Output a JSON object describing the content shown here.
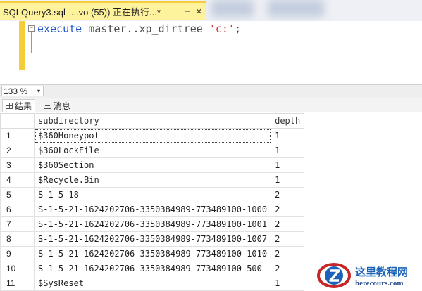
{
  "tab": {
    "title": "SQLQuery3.sql -...vo (55)) 正在执行...*",
    "pin_icon": "pin-icon",
    "close_icon": "close-icon"
  },
  "editor": {
    "fold_glyph": "−",
    "code": {
      "keyword": "execute",
      "object": " master..xp_dirtree ",
      "string": "'c:'",
      "terminator": ";"
    }
  },
  "zoom": {
    "value": "133 %",
    "arrow": "▾"
  },
  "results_tabs": [
    {
      "label": "结果",
      "icon": "grid-icon"
    },
    {
      "label": "消息",
      "icon": "message-icon"
    }
  ],
  "grid": {
    "columns": [
      "subdirectory",
      "depth"
    ],
    "rows": [
      {
        "n": "1",
        "subdirectory": "$360Honeypot",
        "depth": "1"
      },
      {
        "n": "2",
        "subdirectory": "$360LockFile",
        "depth": "1"
      },
      {
        "n": "3",
        "subdirectory": "$360Section",
        "depth": "1"
      },
      {
        "n": "4",
        "subdirectory": "$Recycle.Bin",
        "depth": "1"
      },
      {
        "n": "5",
        "subdirectory": "S-1-5-18",
        "depth": "2"
      },
      {
        "n": "6",
        "subdirectory": "S-1-5-21-1624202706-3350384989-773489100-1000",
        "depth": "2"
      },
      {
        "n": "7",
        "subdirectory": "S-1-5-21-1624202706-3350384989-773489100-1001",
        "depth": "2"
      },
      {
        "n": "8",
        "subdirectory": "S-1-5-21-1624202706-3350384989-773489100-1007",
        "depth": "2"
      },
      {
        "n": "9",
        "subdirectory": "S-1-5-21-1624202706-3350384989-773489100-1010",
        "depth": "2"
      },
      {
        "n": "10",
        "subdirectory": "S-1-5-21-1624202706-3350384989-773489100-500",
        "depth": "2"
      },
      {
        "n": "11",
        "subdirectory": "$SysReset",
        "depth": "1"
      }
    ]
  },
  "watermark": {
    "site_name": "这里教程网",
    "url": "herecours.com",
    "logo": "z-logo"
  },
  "colors": {
    "tab_active": "#fff29d",
    "keyword": "#2356c6",
    "string": "#d32f2f",
    "watermark_blue": "#1b63b8"
  }
}
